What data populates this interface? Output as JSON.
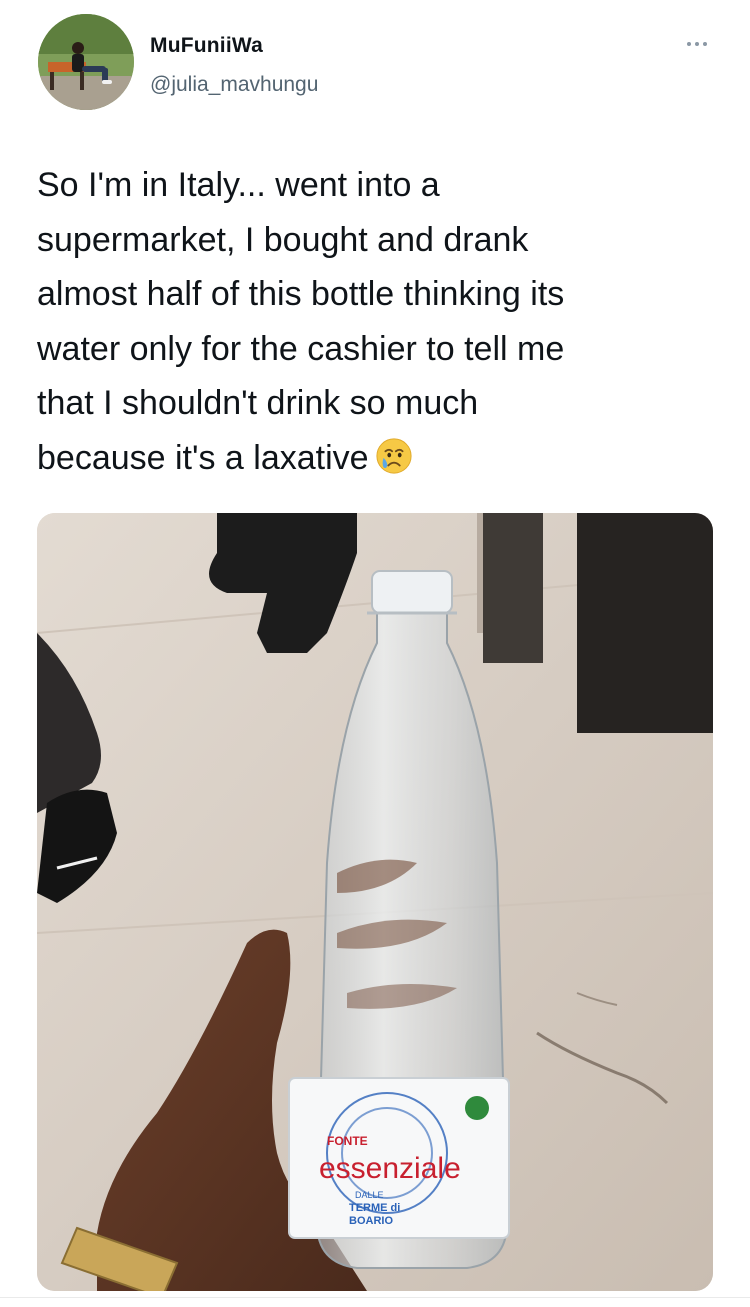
{
  "tweet": {
    "display_name": "MuFuniiWa",
    "handle": "@julia_mavhungu",
    "text": "So I'm in Italy... went into a\nsupermarket, I bought and drank\nalmost half of this bottle thinking its\nwater only for the cashier to tell me\nthat I shouldn't drink so much\nbecause it's a laxative",
    "emoji": "crying-face-icon",
    "more_icon": "more-horizontal-icon"
  },
  "photo": {
    "label_brand_small": "FONTE",
    "label_brand_main": "essenziale",
    "label_sub_1": "DALLE",
    "label_sub_2": "TERME di",
    "label_sub_3": "BOARIO"
  },
  "colors": {
    "text_primary": "#0f1419",
    "text_secondary": "#536471",
    "brand_red": "#c8202f",
    "brand_blue": "#2a62b8"
  }
}
